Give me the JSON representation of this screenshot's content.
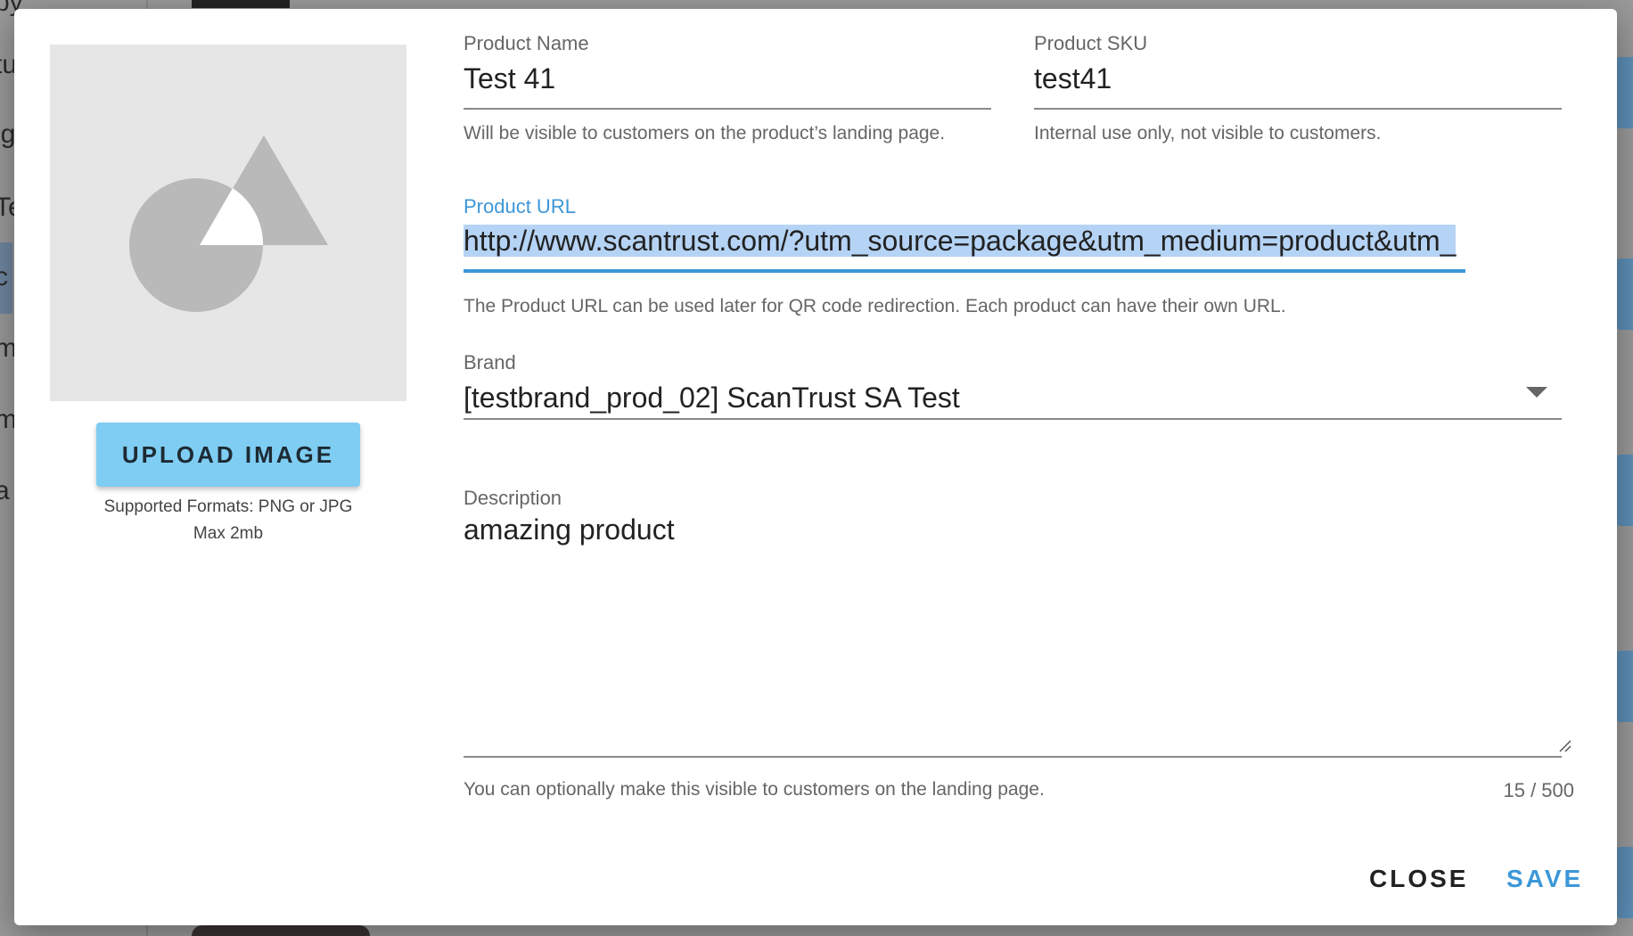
{
  "background": {
    "left_fragments": [
      "py",
      "tu",
      "ig",
      "Te",
      "c",
      "m",
      "m",
      "a"
    ]
  },
  "image_panel": {
    "upload_label": "UPLOAD IMAGE",
    "formats_note": "Supported Formats: PNG or JPG",
    "size_note": "Max 2mb"
  },
  "form": {
    "product_name": {
      "label": "Product Name",
      "value": "Test 41",
      "helper": "Will be visible to customers on the product’s landing page."
    },
    "product_sku": {
      "label": "Product SKU",
      "value": "test41",
      "helper": "Internal use only, not visible to customers."
    },
    "product_url": {
      "label": "Product URL",
      "value": "http://www.scantrust.com/?utm_source=package&utm_medium=product&utm_",
      "helper": "The Product URL can be used later for QR code redirection. Each product can have their own URL."
    },
    "brand": {
      "label": "Brand",
      "value": "[testbrand_prod_02] ScanTrust SA Test"
    },
    "description": {
      "label": "Description",
      "value": "amazing product",
      "helper": "You can optionally make this visible to customers on the landing page.",
      "counter": "15 / 500"
    }
  },
  "actions": {
    "close_label": "CLOSE",
    "save_label": "SAVE"
  },
  "colors": {
    "accent": "#3c97d8",
    "upload_button": "#7fcdf3",
    "selection": "#b5d3f5"
  }
}
